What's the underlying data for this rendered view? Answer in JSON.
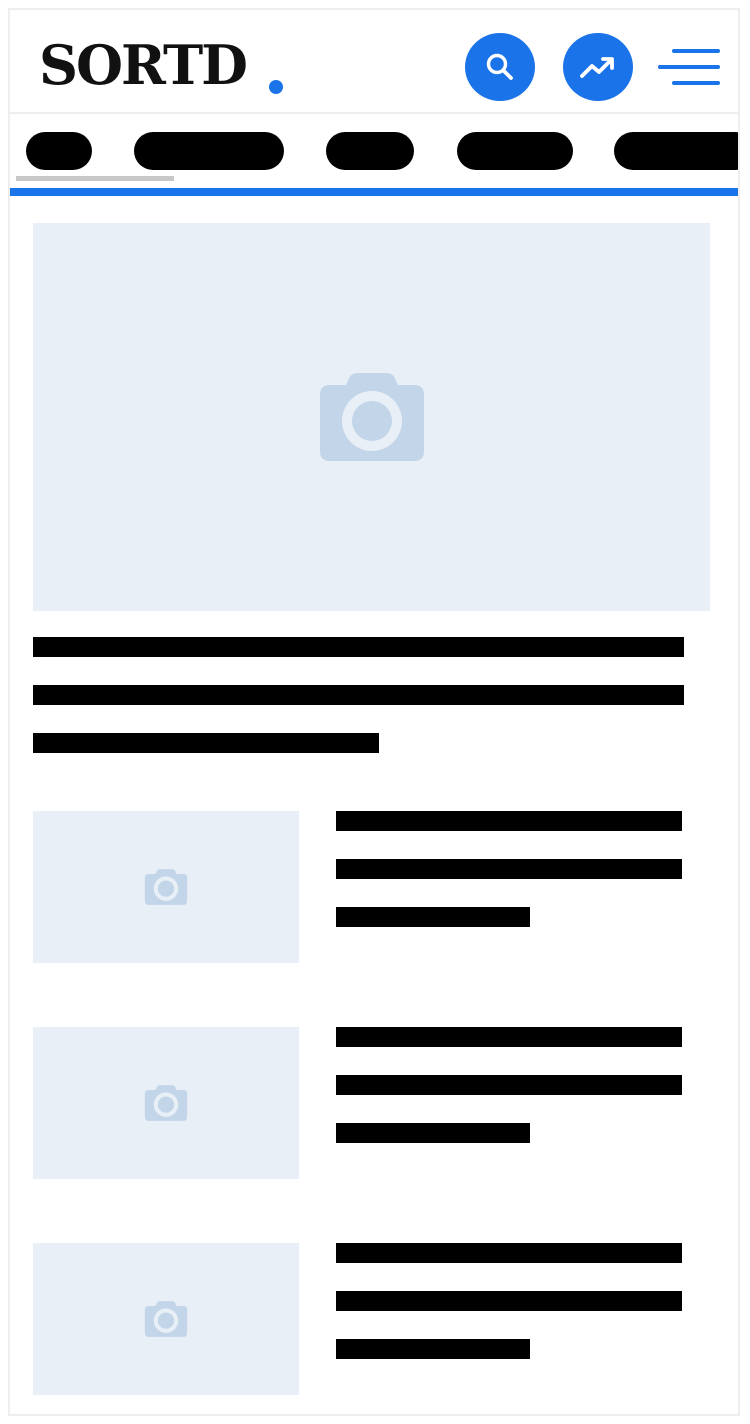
{
  "header": {
    "logo_text": "SORTD",
    "search_icon": "search-icon",
    "trending_icon": "trending-up-icon",
    "menu_icon": "hamburger-menu-icon",
    "accent_color": "#1a73e8"
  },
  "nav": {
    "categories": [
      "",
      "",
      "",
      "",
      ""
    ]
  },
  "hero": {
    "image_icon": "camera-icon",
    "placeholder_color": "#e9eff6",
    "headline_lines": [
      "",
      "",
      ""
    ]
  },
  "articles": [
    {
      "image_icon": "camera-icon",
      "title_lines": [
        "",
        "",
        ""
      ]
    },
    {
      "image_icon": "camera-icon",
      "title_lines": [
        "",
        "",
        ""
      ]
    },
    {
      "image_icon": "camera-icon",
      "title_lines": [
        "",
        "",
        ""
      ]
    }
  ]
}
